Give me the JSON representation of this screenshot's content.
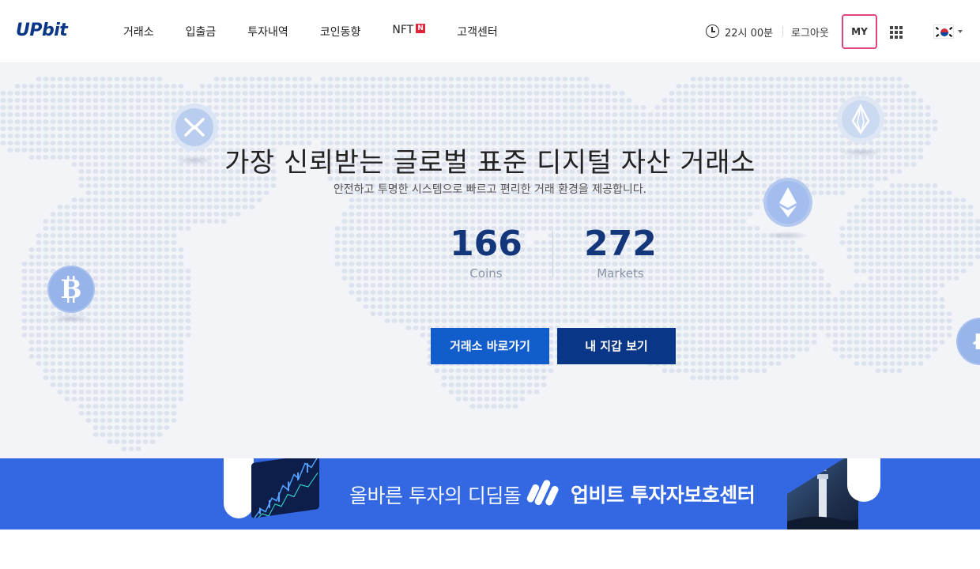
{
  "header": {
    "logo": "UPbit",
    "nav": [
      "거래소",
      "입출금",
      "투자내역",
      "코인동향",
      "NFT",
      "고객센터"
    ],
    "nft_badge": "N",
    "session_time": "22시 00분",
    "logout": "로그아웃",
    "my_label": "MY",
    "language": "KR"
  },
  "hero": {
    "title": "가장 신뢰받는 글로벌 표준 디지털 자산 거래소",
    "subtitle": "안전하고 투명한 시스템으로 빠르고 편리한 거래 환경을 제공합니다.",
    "coins_count": "166",
    "coins_label": "Coins",
    "markets_count": "272",
    "markets_label": "Markets",
    "btn_exchange": "거래소 바로가기",
    "btn_wallet": "내 지갑 보기",
    "coin_icons": [
      "ripple-icon",
      "bitcoin-icon",
      "eos-icon",
      "ethereum-icon",
      "litecoin-icon"
    ]
  },
  "banner": {
    "text": "올바른 투자의 디딤돌",
    "brand": "업비트 투자자보호센터"
  },
  "colors": {
    "primary": "#093687",
    "accent_blue": "#115dcb",
    "banner_blue": "#3468e3",
    "my_border": "#e0437e",
    "nft_badge": "#e0253b"
  }
}
